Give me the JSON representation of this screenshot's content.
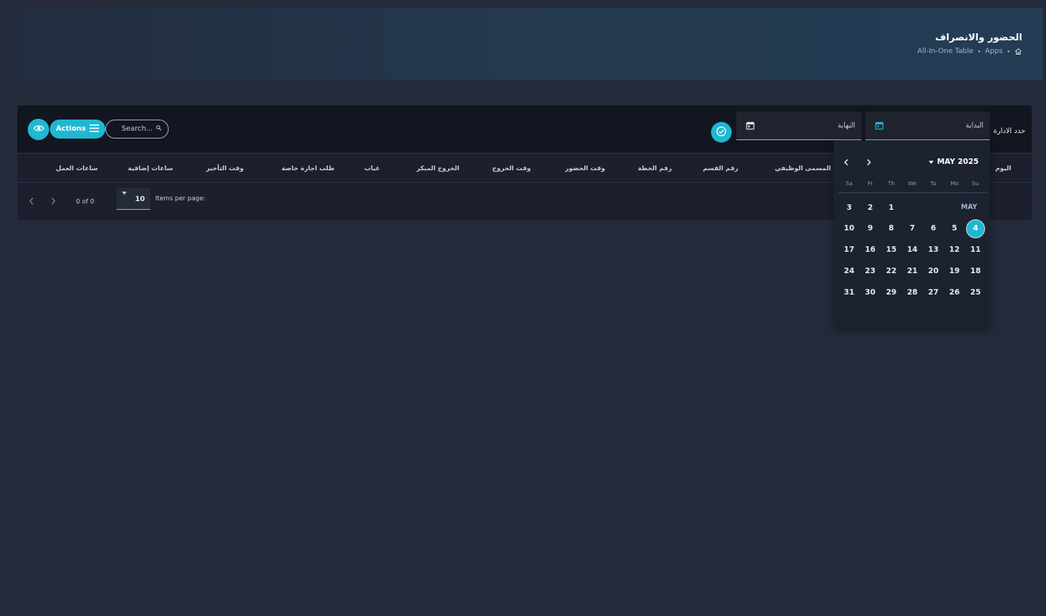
{
  "header": {
    "title": "الحضور والانصراف",
    "breadcrumb": [
      "Apps",
      "All-In-One Table"
    ],
    "separator": "•"
  },
  "toolbar": {
    "actions_label": "Actions",
    "search_placeholder": "Search...",
    "end_date_label": "النهاية",
    "start_date_label": "البداية",
    "department_label": "حدد الادارة"
  },
  "table": {
    "columns": [
      "اليوم",
      "المسمى الوظيفي",
      "رقم القسم",
      "رقم الخطة",
      "وقت الحضور",
      "وقت الخروج",
      "الخروج المبكر",
      "غياب",
      "طلب اجازة خاصة",
      "وقت التأخير",
      "ساعات إضافية",
      "ساعات العمل"
    ]
  },
  "paginator": {
    "items_per_page_label": "Items per page:",
    "items_per_page_value": "10",
    "range_label": "0 of 0"
  },
  "calendar": {
    "period_label": "MAY 2025",
    "month_label": "MAY",
    "weekdays": [
      "Su",
      "Mo",
      "Tu",
      "We",
      "Th",
      "Fr",
      "Sa"
    ],
    "selected_day": 4,
    "weeks": [
      [
        "",
        "",
        "",
        "",
        1,
        2,
        3
      ],
      [
        4,
        5,
        6,
        7,
        8,
        9,
        10
      ],
      [
        11,
        12,
        13,
        14,
        15,
        16,
        17
      ],
      [
        18,
        19,
        20,
        21,
        22,
        23,
        24
      ],
      [
        25,
        26,
        27,
        28,
        29,
        30,
        31
      ]
    ]
  },
  "colors": {
    "accent": "#1fb8d3",
    "background": "#252a3b",
    "card": "#1b1f2e"
  }
}
